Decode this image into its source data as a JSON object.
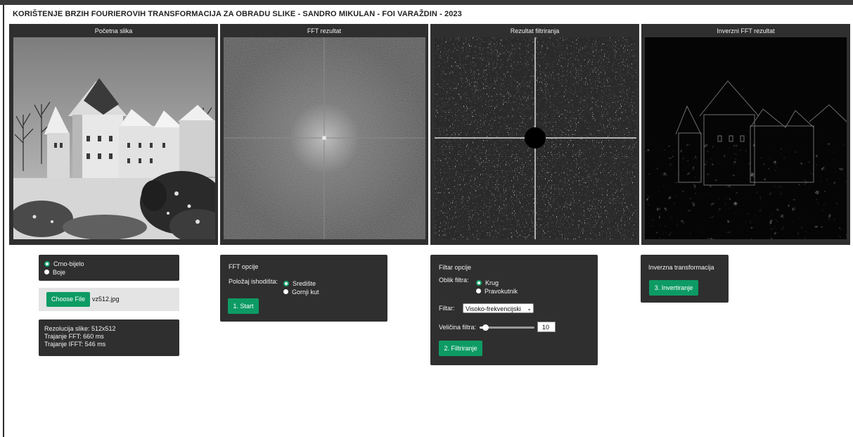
{
  "title": "KORIŠTENJE BRZIH FOURIEROVIH TRANSFORMACIJA ZA OBRADU SLIKE - SANDRO MIKULAN - FOI VARAŽDIN - 2023",
  "panels": [
    {
      "title": "Početna slika"
    },
    {
      "title": "FFT rezultat"
    },
    {
      "title": "Rezultat filtriranja"
    },
    {
      "title": "Inverzni FFT rezultat"
    }
  ],
  "color_mode": {
    "options": [
      "Crno-bijelo",
      "Boje"
    ],
    "selected": "Crno-bijelo"
  },
  "file": {
    "button": "Choose File",
    "filename": "vz512.jpg"
  },
  "info": {
    "resolution": "Rezolucija slike: 512x512",
    "fft_time": "Trajanje FFT: 660 ms",
    "ifft_time": "Trajanje IFFT: 546 ms"
  },
  "fft_options": {
    "heading": "FFT opcije",
    "origin_label": "Položaj ishodišta:",
    "origin_options": [
      "Središte",
      "Gornji kut"
    ],
    "selected": "Središte",
    "start_button": "1. Start"
  },
  "filter_options": {
    "heading": "Filtar opcije",
    "shape_label": "Oblik filtra:",
    "shape_options": [
      "Krug",
      "Pravokutnik"
    ],
    "selected_shape": "Krug",
    "filter_label": "Filtar:",
    "filter_value": "Visoko-frekvencijski",
    "size_label": "Veličina filtra:",
    "size_value": "10",
    "size_fraction": 0.1,
    "filter_button": "2. Filtriranje"
  },
  "inverse": {
    "heading": "Inverzna transformacija",
    "button": "3. Invertiranje"
  },
  "colors": {
    "accent": "#0d9b64",
    "panel": "#2f2f2f"
  }
}
